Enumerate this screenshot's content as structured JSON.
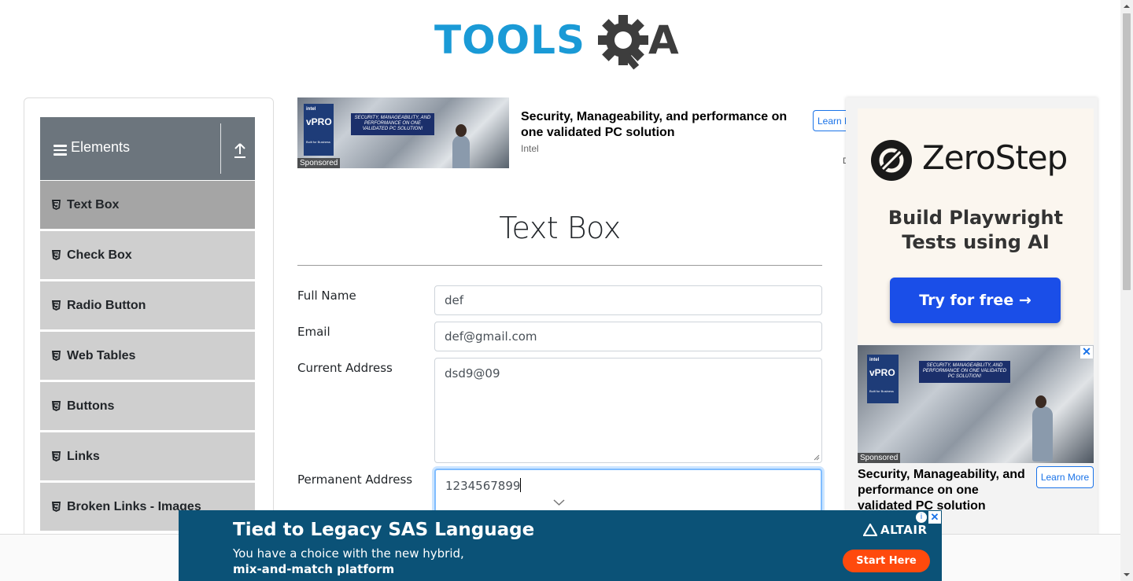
{
  "logo": {
    "text_left": "TOOLS",
    "text_right": "A"
  },
  "sidebar": {
    "group_title": "Elements",
    "items": [
      {
        "label": "Text Box",
        "active": true
      },
      {
        "label": "Check Box"
      },
      {
        "label": "Radio Button"
      },
      {
        "label": "Web Tables"
      },
      {
        "label": "Buttons"
      },
      {
        "label": "Links"
      },
      {
        "label": "Broken Links - Images"
      }
    ]
  },
  "top_ad": {
    "title": "Security, Manageability, and performance on one validated PC solution",
    "brand": "Intel",
    "learn_more": "Learn M",
    "sponsored": "Sponsored",
    "badge_brand": "intel",
    "badge_text": "vPRO",
    "badge_sub": "Built for Business",
    "banner_text": "SECURITY, MANAGEABILITY, AND PERFORMANCE ON ONE VALIDATED PC SOLUTION!",
    "ad_choice": "D"
  },
  "main": {
    "title": "Text Box",
    "form": {
      "full_name": {
        "label": "Full Name",
        "value": "def"
      },
      "email": {
        "label": "Email",
        "value": "def@gmail.com"
      },
      "current_address": {
        "label": "Current Address",
        "value": "dsd9@09"
      },
      "permanent_address": {
        "label": "Permanent Address",
        "value": "1234567899"
      }
    }
  },
  "right_ad": {
    "brand": "ZeroStep",
    "headline": "Build Playwright Tests using AI",
    "cta": "Try for free →",
    "sponsored": "Sponsored",
    "badge_brand": "intel",
    "badge_text": "vPRO",
    "badge_sub": "Built for Business",
    "banner_text": "SECURITY, MANAGEABILITY, AND PERFORMANCE ON ONE VALIDATED PC SOLUTION!",
    "title": "Security, Manageability, and performance on one validated PC solution",
    "learn_more": "Learn More",
    "close": "✕"
  },
  "bottom_ad": {
    "headline": "Tied to Legacy SAS Language",
    "sub_line1": "You have a choice with the new hybrid,",
    "sub_line2": "mix-and-match platform",
    "brand": "ALTAIR",
    "cta": "Start Here",
    "info": "i",
    "close": "✕"
  },
  "colors": {
    "logo_blue": "#1a9ad6",
    "logo_dark": "#3d3d3d",
    "sidebar_header": "#6c757d",
    "sidebar_item": "#cfcfcf",
    "sidebar_item_active": "#a5a5a5",
    "cta_blue": "#1a4ee8",
    "bottom_ad_bg": "#0b5277",
    "bottom_ad_cta": "#ff4a0d"
  }
}
